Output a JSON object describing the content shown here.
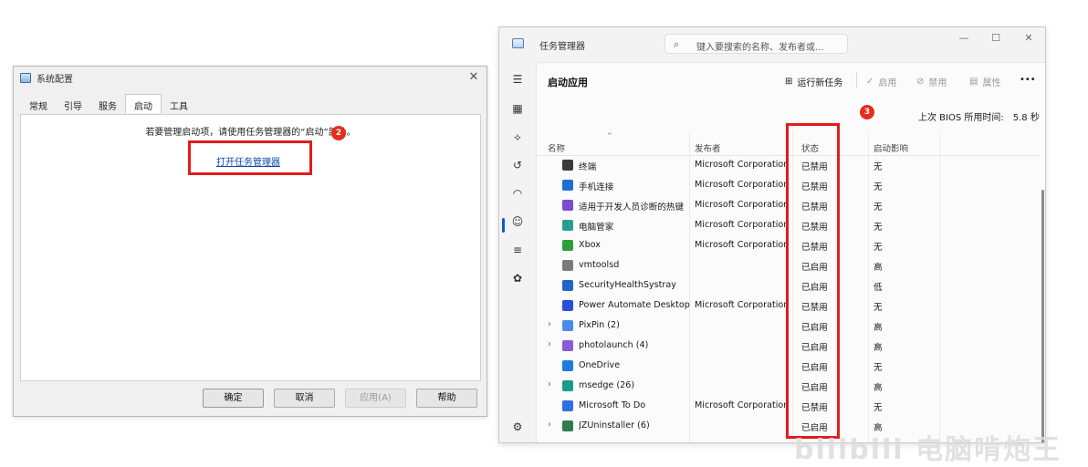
{
  "msconfig": {
    "title": "系统配置",
    "close": "✕",
    "tabs": [
      "常规",
      "引导",
      "服务",
      "启动",
      "工具"
    ],
    "active_tab": 3,
    "message": "若要管理启动项，请使用任务管理器的“启动”部分。",
    "link": "打开任务管理器",
    "badge": "2",
    "buttons": {
      "ok": "确定",
      "cancel": "取消",
      "apply": "应用(A)",
      "help": "帮助"
    }
  },
  "taskmgr": {
    "title": "任务管理器",
    "search_placeholder": "键入要搜索的名称、发布者或...",
    "window_controls": {
      "minimize": "—",
      "maximize": "☐",
      "close": "✕"
    },
    "heading": "启动应用",
    "toolbar": {
      "run_new_task": "运行新任务",
      "enable": "启用",
      "disable": "禁用",
      "properties": "属性",
      "more": "•••"
    },
    "badge": "3",
    "bios_label": "上次 BIOS 所用时间:",
    "bios_value": "5.8 秒",
    "columns": {
      "name": "名称",
      "publisher": "发布者",
      "status": "状态",
      "impact": "启动影响"
    },
    "rows": [
      {
        "expand": "",
        "icon": "terminal-icon",
        "icon_color": "#3b3b3b",
        "name": "终端",
        "publisher": "Microsoft Corporation",
        "status": "已禁用",
        "impact": "无"
      },
      {
        "expand": "",
        "icon": "phone-link-icon",
        "icon_color": "#1f6fd1",
        "name": "手机连接",
        "publisher": "Microsoft Corporation",
        "status": "已禁用",
        "impact": "无"
      },
      {
        "expand": "",
        "icon": "dev-home-icon",
        "icon_color": "#7b4bd1",
        "name": "适用于开发人员诊断的热键",
        "publisher": "Microsoft Corporation",
        "status": "已禁用",
        "impact": "无"
      },
      {
        "expand": "",
        "icon": "pc-manager-icon",
        "icon_color": "#2a9d8f",
        "name": "电脑管家",
        "publisher": "Microsoft Corporation",
        "status": "已禁用",
        "impact": "无"
      },
      {
        "expand": "",
        "icon": "xbox-icon",
        "icon_color": "#2f9e3a",
        "name": "Xbox",
        "publisher": "Microsoft Corporation",
        "status": "已禁用",
        "impact": "无"
      },
      {
        "expand": "",
        "icon": "vmware-icon",
        "icon_color": "#7a7a7a",
        "name": "vmtoolsd",
        "publisher": "",
        "status": "已启用",
        "impact": "高"
      },
      {
        "expand": "",
        "icon": "shield-icon",
        "icon_color": "#2563c9",
        "name": "SecurityHealthSystray",
        "publisher": "",
        "status": "已启用",
        "impact": "低"
      },
      {
        "expand": "",
        "icon": "power-automate-icon",
        "icon_color": "#2a4fd6",
        "name": "Power Automate Desktop",
        "publisher": "Microsoft Corporation",
        "status": "已禁用",
        "impact": "无"
      },
      {
        "expand": "›",
        "icon": "pixpin-icon",
        "icon_color": "#4a8be8",
        "name": "PixPin (2)",
        "publisher": "",
        "status": "已启用",
        "impact": "高"
      },
      {
        "expand": "›",
        "icon": "photolaunch-icon",
        "icon_color": "#8a5cd6",
        "name": "photolaunch (4)",
        "publisher": "",
        "status": "已启用",
        "impact": "高"
      },
      {
        "expand": "",
        "icon": "onedrive-icon",
        "icon_color": "#1e7be0",
        "name": "OneDrive",
        "publisher": "",
        "status": "已启用",
        "impact": "无"
      },
      {
        "expand": "›",
        "icon": "edge-icon",
        "icon_color": "#1a9b8c",
        "name": "msedge (26)",
        "publisher": "",
        "status": "已启用",
        "impact": "高"
      },
      {
        "expand": "",
        "icon": "todo-icon",
        "icon_color": "#2f6fe0",
        "name": "Microsoft To Do",
        "publisher": "Microsoft Corporation",
        "status": "已禁用",
        "impact": "无"
      },
      {
        "expand": "›",
        "icon": "jz-uninstaller-icon",
        "icon_color": "#2e7d4f",
        "name": "JZUninstaller (6)",
        "publisher": "",
        "status": "已启用",
        "impact": "高"
      }
    ]
  },
  "watermark": "bilibili 电脑啃炮王"
}
